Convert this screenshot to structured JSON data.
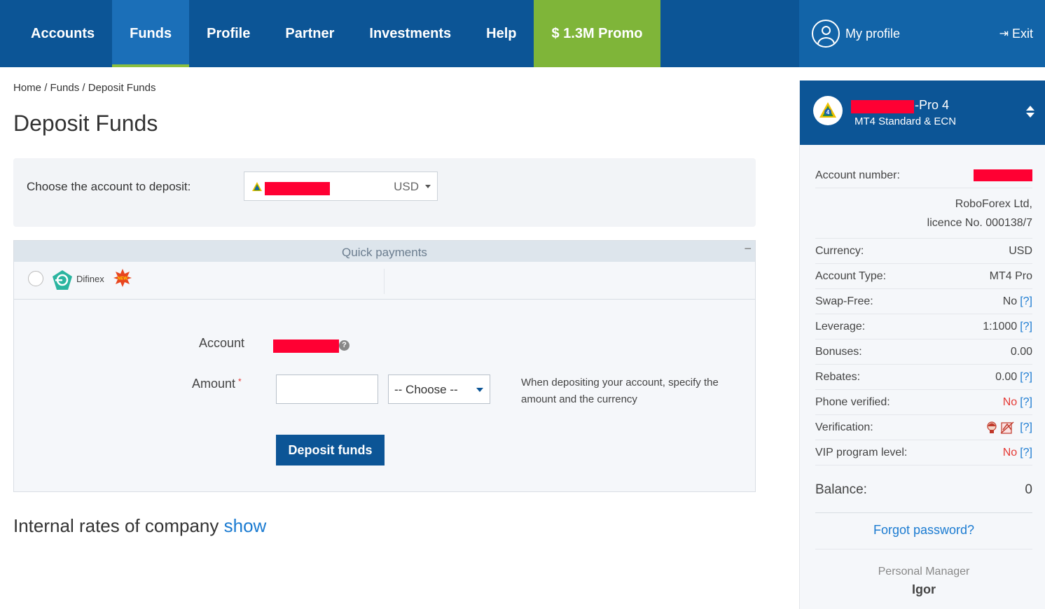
{
  "nav": {
    "items": [
      {
        "label": "Accounts"
      },
      {
        "label": "Funds",
        "active": true
      },
      {
        "label": "Profile"
      },
      {
        "label": "Partner"
      },
      {
        "label": "Investments"
      },
      {
        "label": "Help"
      },
      {
        "label": "$ 1.3M Promo",
        "promo": true
      }
    ],
    "my_profile": "My profile",
    "exit": "Exit"
  },
  "breadcrumb": {
    "home": "Home",
    "funds": "Funds",
    "current": "Deposit Funds",
    "separator": "/"
  },
  "page_title": "Deposit Funds",
  "choose_account": {
    "label": "Choose the account to deposit:",
    "currency": "USD"
  },
  "quick_payments": {
    "title": "Quick payments",
    "collapse": "−",
    "method": {
      "name": "Difinex",
      "badge": "NEW"
    }
  },
  "form": {
    "account_label": "Account",
    "amount_label": "Amount",
    "required_mark": "*",
    "amount_value": "",
    "currency_choose": "-- Choose --",
    "hint": "When depositing your account, specify the amount and the currency",
    "submit": "Deposit funds"
  },
  "rates": {
    "text": "Internal rates of company",
    "link": "show"
  },
  "right_panel": {
    "account_name_suffix": "-Pro 4",
    "account_type": "MT4 Standard & ECN",
    "rows": {
      "account_number_label": "Account number:",
      "company": "RoboForex Ltd,",
      "licence": "licence No. 000138/7",
      "currency_label": "Currency:",
      "currency_value": "USD",
      "account_type_label": "Account Type:",
      "account_type_value": "MT4 Pro",
      "swap_label": "Swap-Free:",
      "swap_value": "No",
      "leverage_label": "Leverage:",
      "leverage_value": "1:1000",
      "bonuses_label": "Bonuses:",
      "bonuses_value": "0.00",
      "rebates_label": "Rebates:",
      "rebates_value": "0.00",
      "phone_label": "Phone verified:",
      "phone_value": "No",
      "verification_label": "Verification:",
      "vip_label": "VIP program level:",
      "vip_value": "No",
      "balance_label": "Balance:",
      "balance_value": "0"
    },
    "qmark": "[?]",
    "forgot_password": "Forgot password?",
    "personal_manager_label": "Personal Manager",
    "personal_manager_name": "Igor"
  },
  "colors": {
    "nav_bg": "#0c5596",
    "nav_active": "#1b6fb8",
    "promo_green": "#7fb539",
    "link_blue": "#1b7bd1",
    "redaction": "#ff0033",
    "warning_red": "#e53935"
  },
  "icons": [
    "user-icon",
    "exit-icon",
    "mt4-icon",
    "difinex-icon",
    "new-badge-icon",
    "help-icon",
    "sort-arrows-icon",
    "verification-id-icon",
    "verification-doc-icon"
  ]
}
